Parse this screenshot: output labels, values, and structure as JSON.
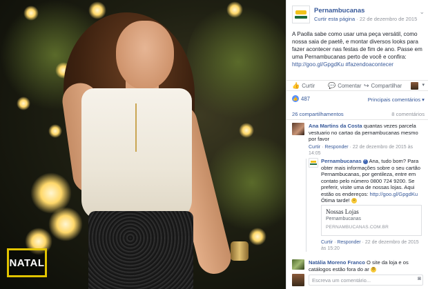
{
  "photo": {
    "badge_text": "NATAL",
    "accent_yellow": "#e2c400"
  },
  "page": {
    "name": "Pernambucanas",
    "like_page": "Curtir esta página",
    "separator": " · ",
    "date": "22 de dezembro de 2015",
    "menu_icon": "chevron-down-icon"
  },
  "post": {
    "text": "A Paolla sabe como usar uma peça versátil, como nossa saia de paetê, e montar diversos looks para fazer acontecer nas festas de fim de ano. Passe em uma Pernambucanas perto de você e confira: ",
    "link": "http://goo.gl/GpgdKu #fazendoacontecer"
  },
  "actions": {
    "like": "Curtir",
    "comment": "Comentar",
    "share": "Compartilhar"
  },
  "reactions": {
    "count": "487",
    "filter": "Principais comentários ▾"
  },
  "stats": {
    "shares": "26 compartilhamentos",
    "comments": "8 comentários"
  },
  "comments": [
    {
      "name": "Ana Martins da Costa",
      "text": " quantas vezes parcela vestuario no cartao da pernambucanas mesmo por favor",
      "like": "Curtir",
      "reply": "Responder",
      "time": "22 de dezembro de 2015 às 14:05"
    },
    {
      "name": "Pernambucanas",
      "text": " Ana, tudo bom? Para obter mais informações sobre o seu cartão Pernambucanas, por gentileza, entre em contato pelo número 0800 724 9200. Se preferir, visite uma de nossas lojas. Aqui estão os endereços: ",
      "link": "http://goo.gl/GpgdKu",
      "tail": " Ótima tarde!",
      "card_title": "Nossas Lojas",
      "card_sub": "Pernambucanas",
      "card_domain": "PERNAMBUCANAS.COM.BR",
      "like": "Curtir",
      "reply": "Responder",
      "time": "22 de dezembro de 2015 às 15:20"
    },
    {
      "name": "Natália Moreno Franco",
      "text": " O site da loja e os catálogos estão fora do ar"
    }
  ],
  "composer": {
    "placeholder": "Escreva um comentário..."
  }
}
